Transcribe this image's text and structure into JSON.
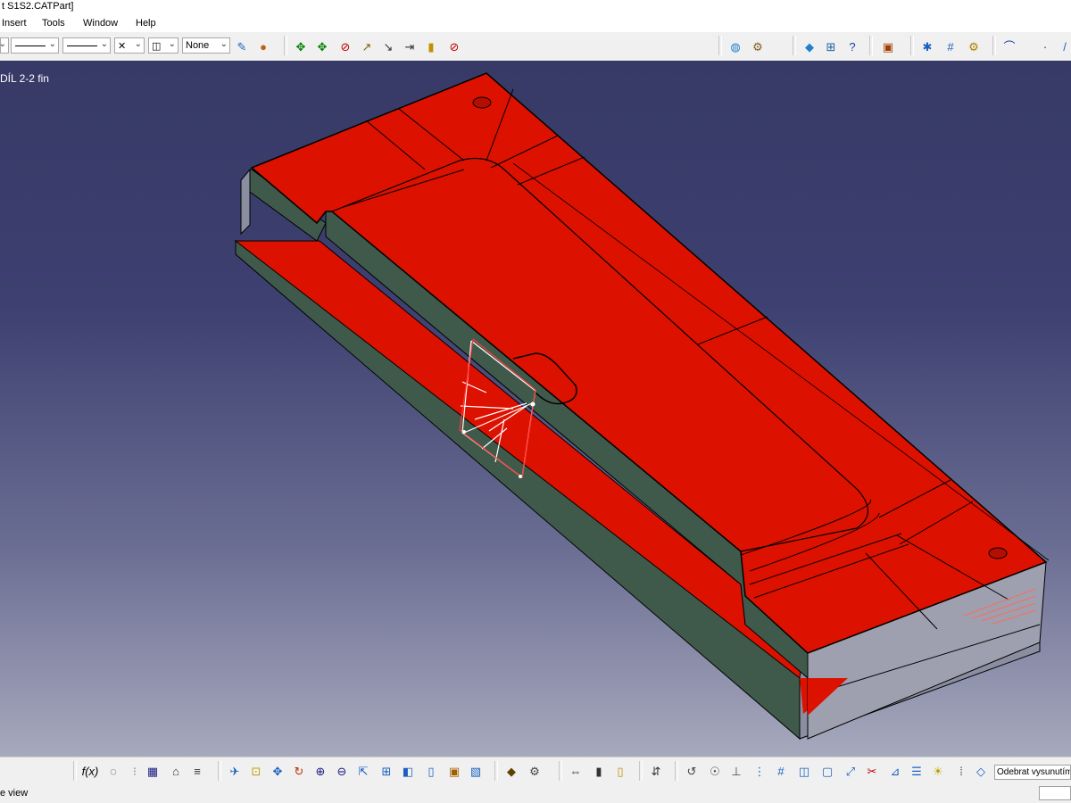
{
  "window": {
    "title": "t S1S2.CATPart]"
  },
  "menu": {
    "items": [
      "Insert",
      "Tools",
      "Window",
      "Help"
    ]
  },
  "toolbar_top": {
    "layer_value": "None",
    "icons": [
      "line-thickness-combo",
      "line-type-combo",
      "point-type-combo",
      "layer-combo",
      "painter-icon",
      "apply-material-icon",
      "move-icon",
      "snap-icon",
      "measure-icon",
      "axis-icon",
      "compass-icon",
      "analysis-icon",
      "no-show-icon",
      "globe-icon",
      "render-icon",
      "surface-icon",
      "transform-icon",
      "help-icon",
      "catalog-icon",
      "grid-icon",
      "plane-icon",
      "law-icon",
      "curve-icon"
    ]
  },
  "viewport": {
    "part_label": "DÍL 2-2 fin",
    "part_color": "#dd1100",
    "side_color": "#3f5a4a",
    "background_top": "#373a66",
    "background_bottom": "#a7a9bd"
  },
  "toolbar_bottom": {
    "search_text": "Odebrat vysunutím"
  },
  "status": {
    "message": "e view"
  }
}
